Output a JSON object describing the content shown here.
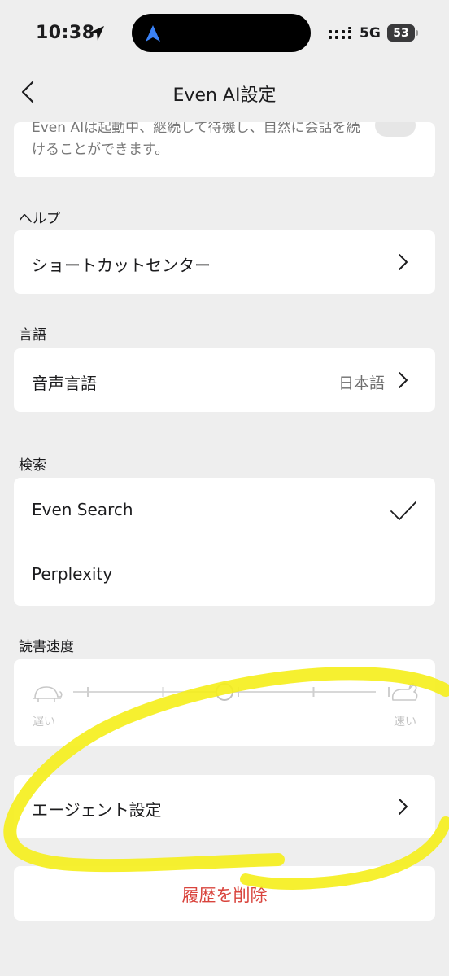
{
  "status_bar": {
    "time": "10:38",
    "network": "5G",
    "battery": "53"
  },
  "nav": {
    "title": "Even AI設定"
  },
  "continuous": {
    "description": "Even AIは起動中、継続して待機し、自然に会話を続けることができます。",
    "enabled": false
  },
  "help": {
    "section_title": "ヘルプ",
    "shortcut_center_label": "ショートカットセンター"
  },
  "language": {
    "section_title": "言語",
    "voice_language_label": "音声言語",
    "voice_language_value": "日本語"
  },
  "search": {
    "section_title": "検索",
    "options": [
      {
        "label": "Even Search",
        "selected": true
      },
      {
        "label": "Perplexity",
        "selected": false
      }
    ]
  },
  "reading_speed": {
    "section_title": "読書速度",
    "slow_label": "遅い",
    "fast_label": "速い",
    "steps": 5,
    "selected_step": 3
  },
  "agent": {
    "label": "エージェント設定"
  },
  "delete_history": {
    "label": "履歴を削除"
  },
  "colors": {
    "accent_red": "#d9443d",
    "highlight": "#f5ee1a",
    "background": "#eeeeee"
  },
  "icons": [
    "location-arrow-icon",
    "navigation-icon",
    "signal-icon",
    "battery-icon",
    "back-icon",
    "chevron-right-icon",
    "checkmark-icon",
    "turtle-icon",
    "rabbit-icon"
  ]
}
